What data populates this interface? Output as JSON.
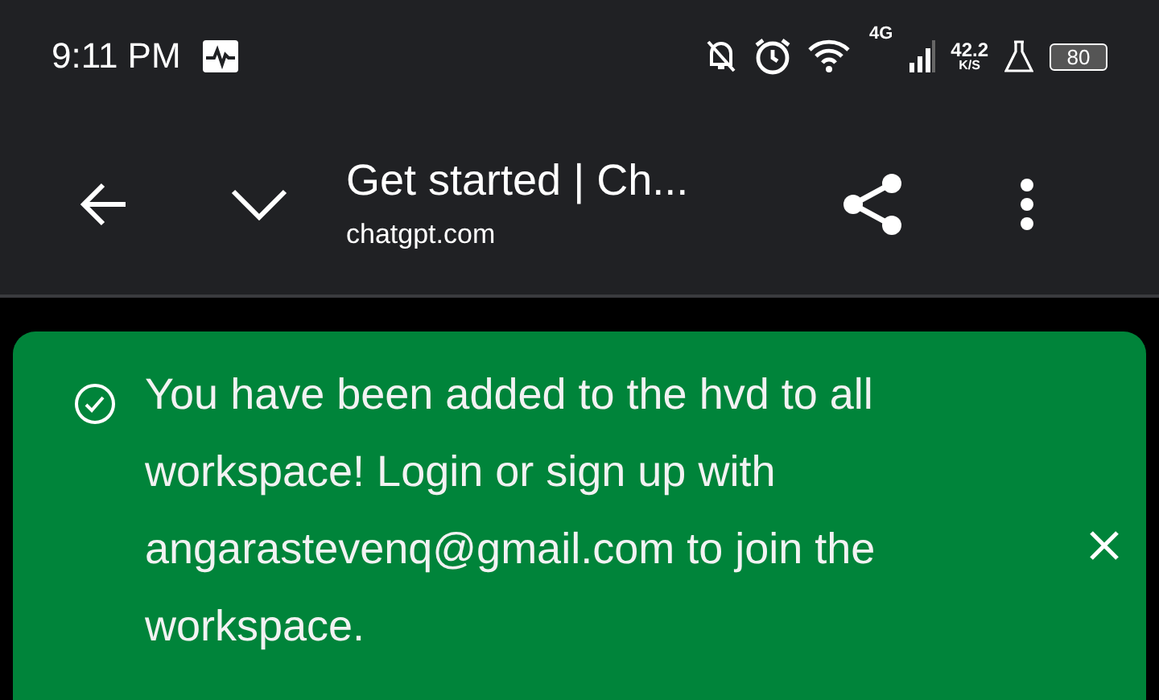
{
  "status_bar": {
    "time": "9:11 PM",
    "network_type": "4G",
    "speed": "42.2",
    "speed_unit": "K/S",
    "battery": "80"
  },
  "toolbar": {
    "title": "Get started | Ch...",
    "url": "chatgpt.com"
  },
  "banner": {
    "message": "You have been added to the hvd to all workspace! Login or sign up with angarastevenq@gmail.com to join the workspace."
  }
}
